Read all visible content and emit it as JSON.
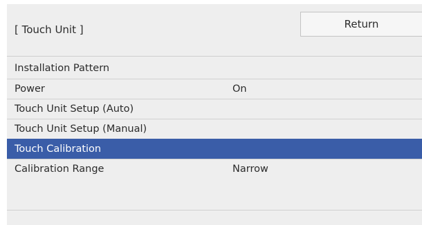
{
  "header": {
    "title": "[ Touch Unit ]",
    "return_label": "Return"
  },
  "menu": {
    "items": [
      {
        "label": "Installation Pattern",
        "value": ""
      },
      {
        "label": "Power",
        "value": "On"
      },
      {
        "label": "Touch Unit Setup (Auto)",
        "value": ""
      },
      {
        "label": "Touch Unit Setup (Manual)",
        "value": ""
      },
      {
        "label": "Touch Calibration",
        "value": "",
        "selected": true
      },
      {
        "label": "Calibration Range",
        "value": "Narrow"
      }
    ]
  },
  "colors": {
    "panel_background": "#eeeeee",
    "selection": "#3a5da8",
    "text": "#2b2b2b"
  }
}
